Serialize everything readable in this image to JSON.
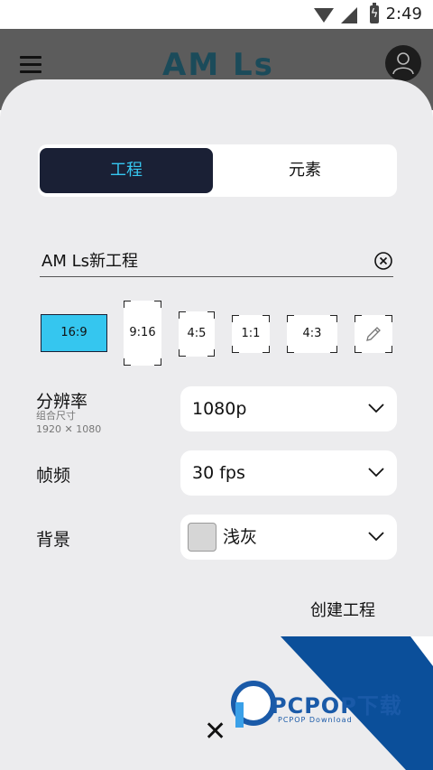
{
  "status_bar": {
    "time": "2:49",
    "icons": [
      "wifi-icon",
      "signal-off-icon",
      "battery-charging-icon"
    ]
  },
  "app_header": {
    "logo_text": "AM Ls",
    "menu_icon": "hamburger-icon",
    "profile_icon": "user-icon"
  },
  "tabs": [
    {
      "label": "工程",
      "selected": true
    },
    {
      "label": "元素",
      "selected": false
    }
  ],
  "project_name": {
    "value": "AM Ls新工程",
    "clear_icon": "clear-circle-icon"
  },
  "aspect_ratios": [
    {
      "label": "16:9",
      "selected": true
    },
    {
      "label": "9:16",
      "selected": false
    },
    {
      "label": "4:5",
      "selected": false
    },
    {
      "label": "1:1",
      "selected": false
    },
    {
      "label": "4:3",
      "selected": false
    },
    {
      "label": "",
      "icon": "pencil-edit-icon",
      "selected": false
    }
  ],
  "settings": {
    "resolution": {
      "label": "分辨率",
      "sub_label": "组合尺寸",
      "sub_value": "1920 ✕ 1080",
      "value": "1080p"
    },
    "frame_rate": {
      "label": "帧频",
      "value": "30 fps"
    },
    "background": {
      "label": "背景",
      "value": "浅灰",
      "swatch_color": "#d6d6d6"
    }
  },
  "create_button": "创建工程",
  "close_icon": "close-x-icon",
  "watermark": {
    "title": "PCPOP下载",
    "subtitle": "PCPOP Download"
  },
  "colors": {
    "accent": "#35c6ef",
    "dark": "#1a2035",
    "sheet_bg": "#ececee",
    "banner_blue": "#0b4f9a"
  }
}
